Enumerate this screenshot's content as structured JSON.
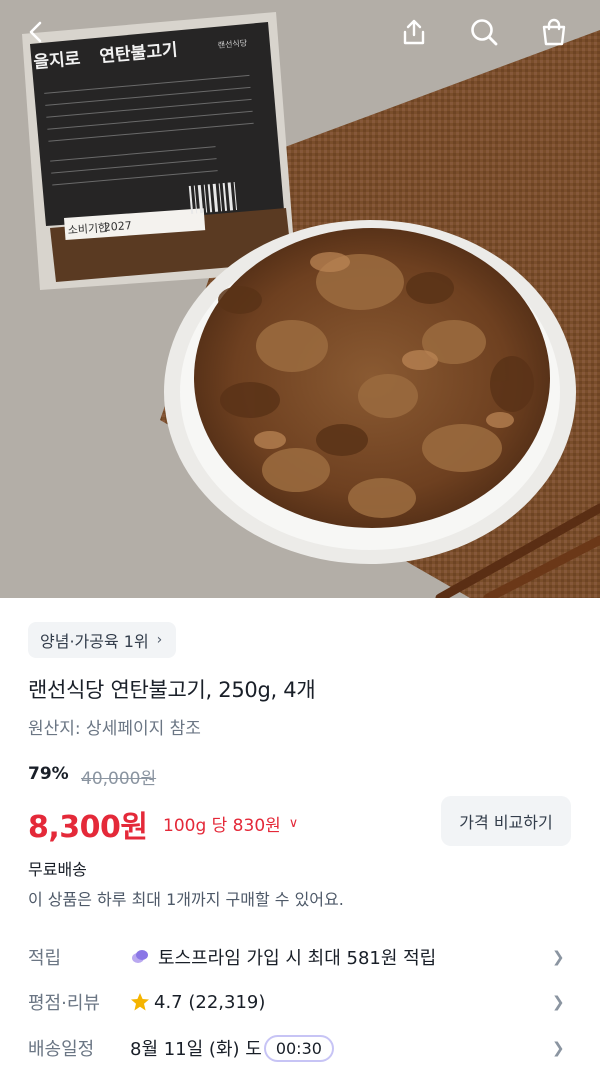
{
  "topbar": {
    "back_icon": "chevron-left-icon",
    "share_icon": "share-icon",
    "search_icon": "search-icon",
    "cart_icon": "shopping-bag-icon"
  },
  "hero": {
    "package_brand": "을지로",
    "package_name": "연탄불고기",
    "package_seal": "랜선식당",
    "package_date_label": "소비기한",
    "package_date_value": "2027"
  },
  "product": {
    "rank_label": "양념·가공육 1위",
    "title": "랜선식당 연탄불고기, 250g, 4개",
    "origin": "원산지: 상세페이지 참조",
    "discount": "79%",
    "original_price": "40,000원",
    "price": "8,300원",
    "unit_price": "100g 당 830원",
    "compare_button": "가격 비교하기",
    "shipping": "무료배송",
    "purchase_limit": "이 상품은 하루 최대 1개까지 구매할 수 있어요."
  },
  "info_rows": {
    "points_label": "적립",
    "points_value": "토스프라임 가입 시 최대 581원 적립",
    "rating_label": "평점·리뷰",
    "rating_value": "4.7 (22,319)",
    "delivery_label": "배송일정",
    "delivery_value": "8월 11일 (화) 도",
    "delivery_timer": "00:30"
  },
  "colors": {
    "price_red": "#e42939",
    "chip_bg": "#f2f4f6",
    "star": "#f5b400",
    "timer_border": "#c7c4f5"
  }
}
